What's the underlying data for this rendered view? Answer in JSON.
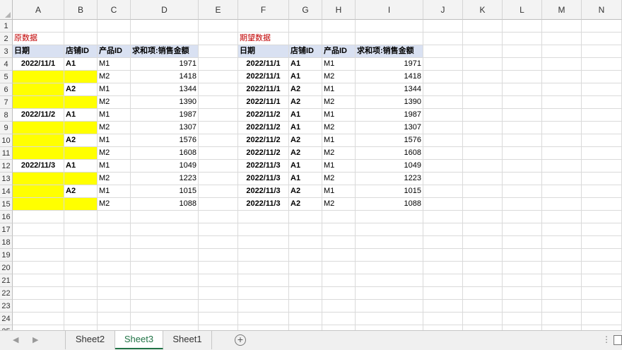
{
  "columns": [
    "A",
    "B",
    "C",
    "D",
    "E",
    "F",
    "G",
    "H",
    "I",
    "J",
    "K",
    "L",
    "M",
    "N"
  ],
  "rows": [
    "1",
    "2",
    "3",
    "4",
    "5",
    "6",
    "7",
    "8",
    "9",
    "10",
    "11",
    "12",
    "13",
    "14",
    "15",
    "16",
    "17",
    "18",
    "19",
    "20",
    "21",
    "22",
    "23",
    "24",
    "25"
  ],
  "left_table": {
    "title": "原数据",
    "headers": [
      "日期",
      "店铺ID",
      "产品ID",
      "求和项:销售金额"
    ],
    "rows": [
      [
        "2022/11/1",
        "A1",
        "M1",
        "1971"
      ],
      [
        "",
        "",
        "M2",
        "1418"
      ],
      [
        "",
        "A2",
        "M1",
        "1344"
      ],
      [
        "",
        "",
        "M2",
        "1390"
      ],
      [
        "2022/11/2",
        "A1",
        "M1",
        "1987"
      ],
      [
        "",
        "",
        "M2",
        "1307"
      ],
      [
        "",
        "A2",
        "M1",
        "1576"
      ],
      [
        "",
        "",
        "M2",
        "1608"
      ],
      [
        "2022/11/3",
        "A1",
        "M1",
        "1049"
      ],
      [
        "",
        "",
        "M2",
        "1223"
      ],
      [
        "",
        "A2",
        "M1",
        "1015"
      ],
      [
        "",
        "",
        "M2",
        "1088"
      ]
    ],
    "highlight_color": "#ffff00"
  },
  "right_table": {
    "title": "期望数据",
    "headers": [
      "日期",
      "店铺ID",
      "产品ID",
      "求和项:销售金额"
    ],
    "rows": [
      [
        "2022/11/1",
        "A1",
        "M1",
        "1971"
      ],
      [
        "2022/11/1",
        "A1",
        "M2",
        "1418"
      ],
      [
        "2022/11/1",
        "A2",
        "M1",
        "1344"
      ],
      [
        "2022/11/1",
        "A2",
        "M2",
        "1390"
      ],
      [
        "2022/11/2",
        "A1",
        "M1",
        "1987"
      ],
      [
        "2022/11/2",
        "A1",
        "M2",
        "1307"
      ],
      [
        "2022/11/2",
        "A2",
        "M1",
        "1576"
      ],
      [
        "2022/11/2",
        "A2",
        "M2",
        "1608"
      ],
      [
        "2022/11/3",
        "A1",
        "M1",
        "1049"
      ],
      [
        "2022/11/3",
        "A1",
        "M2",
        "1223"
      ],
      [
        "2022/11/3",
        "A2",
        "M1",
        "1015"
      ],
      [
        "2022/11/3",
        "A2",
        "M2",
        "1088"
      ]
    ]
  },
  "header_fill_color": "#d9e1f2",
  "title_color": "#c00000",
  "sheet_tabs": [
    {
      "label": "Sheet2",
      "active": false
    },
    {
      "label": "Sheet3",
      "active": true
    },
    {
      "label": "Sheet1",
      "active": false
    }
  ],
  "add_sheet_label": "+",
  "nav_prev": "◀",
  "nav_next": "▶",
  "more_label": "⋮"
}
